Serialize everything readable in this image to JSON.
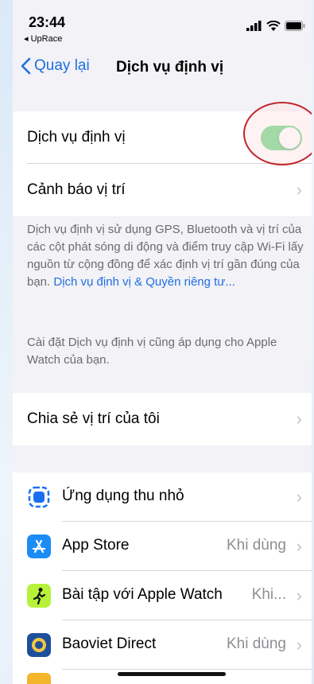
{
  "status_bar": {
    "time": "23:44",
    "back_app": "◂ UpRace"
  },
  "nav": {
    "back_label": "Quay lại",
    "title": "Dịch vụ định vị"
  },
  "location_group": {
    "location_services_label": "Dịch vụ định vị",
    "location_services_on": true,
    "location_alerts_label": "Cảnh báo vị trí"
  },
  "info": {
    "paragraph1": "Dịch vụ định vị sử dụng GPS, Bluetooth và vị trí của các cột phát sóng di động và điểm truy cập Wi-Fi lấy nguồn từ cộng đồng để xác định vị trí gần đúng của bạn.",
    "paragraph1_link": "Dịch vụ định vị & Quyền riêng tư...",
    "paragraph2": "Cài đặt Dịch vụ định vị cũng áp dụng cho Apple Watch của bạn."
  },
  "share": {
    "label": "Chia sẻ vị trí của tôi"
  },
  "apps": [
    {
      "name": "Ứng dụng thu nhỏ",
      "value": "",
      "icon": "app-clips-icon",
      "color": "#1a6ff0"
    },
    {
      "name": "App Store",
      "value": "Khi dùng",
      "icon": "app-store-icon",
      "color": "#1c8cf5"
    },
    {
      "name": "Bài tập với Apple Watch",
      "value": "Khi...",
      "icon": "workout-icon",
      "color": "#b6f23a"
    },
    {
      "name": "Baoviet Direct",
      "value": "Khi dùng",
      "icon": "baoviet-icon",
      "color": "#1e4f9a"
    }
  ],
  "colors": {
    "accent": "#1f6fe0",
    "toggle_on": "#34c759",
    "highlight": "#c0262b"
  }
}
